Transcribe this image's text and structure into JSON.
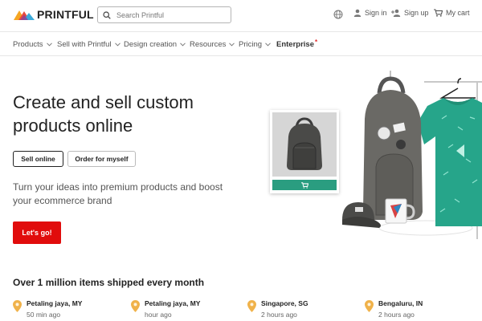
{
  "header": {
    "logo_text": "PRINTFUL",
    "search_placeholder": "Search Printful",
    "sign_in": "Sign in",
    "sign_up": "Sign up",
    "cart": "My cart"
  },
  "nav": {
    "items": [
      {
        "label": "Products",
        "has_dropdown": true
      },
      {
        "label": "Sell with Printful",
        "has_dropdown": true
      },
      {
        "label": "Design creation",
        "has_dropdown": true
      },
      {
        "label": "Resources",
        "has_dropdown": true
      },
      {
        "label": "Pricing",
        "has_dropdown": true
      },
      {
        "label": "Enterprise",
        "has_dropdown": false,
        "marker": "*"
      }
    ]
  },
  "hero": {
    "title": "Create and sell custom products online",
    "chips": [
      "Sell online",
      "Order for myself"
    ],
    "subtitle": "Turn your ideas into premium products and boost your ecommerce brand",
    "cta": "Let's go!"
  },
  "shipped": {
    "title": "Over 1 million items shipped every month",
    "items": [
      {
        "city": "Petaling jaya, MY",
        "time": "50 min ago"
      },
      {
        "city": "Petaling jaya, MY",
        "time": "hour ago"
      },
      {
        "city": "Singapore, SG",
        "time": "2 hours ago"
      },
      {
        "city": "Bengaluru, IN",
        "time": "2 hours ago"
      }
    ]
  },
  "colors": {
    "cta": "#e10c0c",
    "teal": "#2a9d80",
    "pin": "#f0b24a"
  }
}
